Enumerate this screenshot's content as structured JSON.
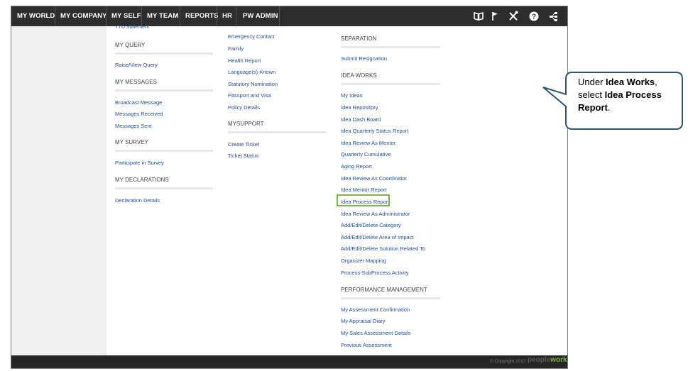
{
  "nav": {
    "items": [
      "MY WORLD",
      "MY COMPANY",
      "MY SELF",
      "MY TEAM",
      "REPORTS",
      "HR",
      "PW ADMIN"
    ],
    "icons": [
      "book-icon",
      "flag-icon",
      "tools-icon",
      "help-icon",
      "share-icon"
    ],
    "help_glyph": "?"
  },
  "col1": {
    "partial_link": "YTD Statement",
    "my_query": "MY QUERY",
    "raise_view_query": "Raise/View Query",
    "my_messages": "MY MESSAGES",
    "broadcast_message": "Broadcast Message",
    "messages_received": "Messages Received",
    "messages_sent": "Messages Sent",
    "my_survey": "MY SURVEY",
    "participate_in_survey": "Participate in Survey",
    "my_declarations": "MY DECLARATIONS",
    "declaration_details": "Declaration Details"
  },
  "col2": {
    "emergency_contact": "Emergency Contact",
    "family": "Family",
    "health_report": "Health Report",
    "languages_known": "Language(s) Known",
    "statutory_nomination": "Statutory Nomination",
    "passport_and_visa": "Passport and Visa",
    "policy_details": "Policy Details",
    "mysupport": "MYSUPPORT",
    "create_ticket": "Create Ticket",
    "ticket_status": "Ticket Status"
  },
  "col3": {
    "separation": "SEPARATION",
    "submit_resignation": "Submit Resignation",
    "idea_works": "IDEA WORKS",
    "my_ideas": "My Ideas",
    "idea_repository": "Idea Repository",
    "idea_dash_board": "Idea Dash Board",
    "idea_quarterly_status_report": "Idea Quarterly Status Report",
    "idea_review_as_mentor": "Idea Review As Mentor",
    "quarterly_cumulative": "Quarterly Cumulative",
    "aging_report": "Aging Report",
    "idea_review_as_coordinator": "Idea Review As Coordinator",
    "idea_mentor_report": "Idea Mentor Report",
    "idea_process_report": "Idea Process Report",
    "idea_review_as_administrator": "Idea Review As Administrator",
    "add_edit_delete_category": "Add/Edit/Delete Category",
    "add_edit_delete_area_of_impact": "Add/Edit/Delete Area of Impact",
    "add_edit_delete_solution_related_to": "Add/Edit/Delete Solution Related To",
    "organizer_mapping": "Organizer Mapping",
    "process_subprocess_activity": "Process-SubProcess Activity",
    "performance_management": "PERFORMANCE MANAGEMENT",
    "my_assessment_confirmation": "My Assessment Confirmation",
    "my_appraisal_diary": "My Appraisal Diary",
    "my_sales_assessment_details": "My Sales Assessment Details",
    "previous_assessment": "Previous Assessment"
  },
  "footer": {
    "copyright": "© Copyright 2017",
    "logo_part1": "people",
    "logo_part2": "works"
  },
  "callout": {
    "line1_pre": "Under ",
    "line1_bold": "Idea Works",
    "line1_post": ",",
    "line2_pre": "select ",
    "line2_bold": "Idea Process Report",
    "line2_post": "."
  },
  "colors": {
    "nav_bg": "#2d2d2d",
    "link": "#1f4e9c",
    "highlight": "#7ab840",
    "callout_border": "#2f5870",
    "logo_people": "#5a5a5a",
    "logo_works": "#7ab840"
  }
}
